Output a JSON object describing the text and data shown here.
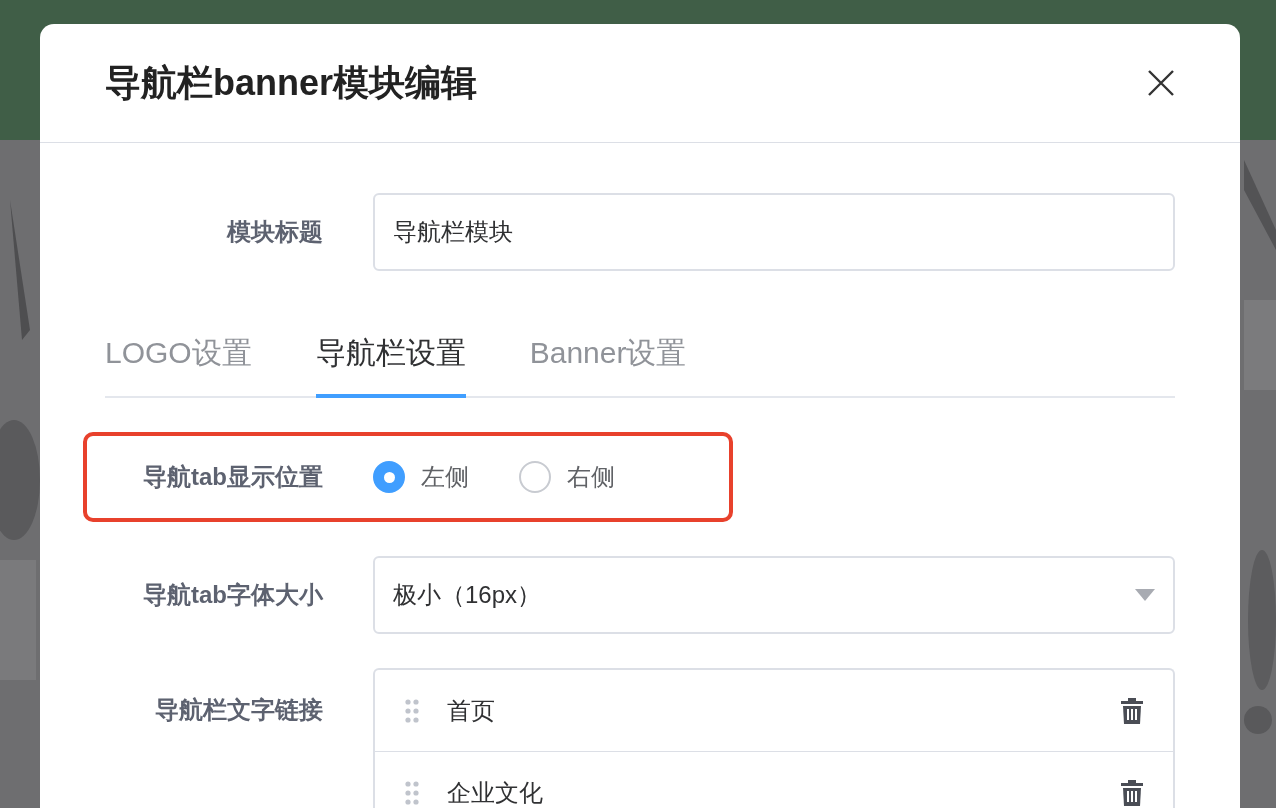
{
  "dialog": {
    "title": "导航栏banner模块编辑"
  },
  "module_title": {
    "label": "模块标题",
    "value": "导航栏模块"
  },
  "tabs": [
    {
      "label": "LOGO设置",
      "selected": false
    },
    {
      "label": "导航栏设置",
      "selected": true
    },
    {
      "label": "Banner设置",
      "selected": false
    }
  ],
  "tab_position": {
    "label": "导航tab显示位置",
    "highlighted": true,
    "options": [
      {
        "label": "左侧",
        "selected": true
      },
      {
        "label": "右侧",
        "selected": false
      }
    ]
  },
  "font_size": {
    "label": "导航tab字体大小",
    "value": "极小（16px）"
  },
  "text_links": {
    "label": "导航栏文字链接",
    "items": [
      {
        "text": "首页"
      },
      {
        "text": "企业文化"
      }
    ]
  }
}
